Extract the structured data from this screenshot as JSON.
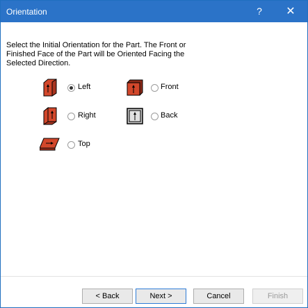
{
  "window": {
    "title": "Orientation",
    "help_glyph": "?",
    "close_glyph": "✕"
  },
  "instructions": "Select the Initial Orientation for the Part.  The Front or\nFinished Face of the Part will be Oriented Facing the\nSelected Direction.",
  "options": {
    "left": {
      "label": "Left",
      "selected": true,
      "icon": "part-left-icon"
    },
    "right": {
      "label": "Right",
      "selected": false,
      "icon": "part-right-icon"
    },
    "top": {
      "label": "Top",
      "selected": false,
      "icon": "part-top-icon"
    },
    "front": {
      "label": "Front",
      "selected": false,
      "icon": "part-front-icon"
    },
    "back": {
      "label": "Back",
      "selected": false,
      "icon": "part-back-icon"
    }
  },
  "buttons": {
    "back": "< Back",
    "next": "Next >",
    "cancel": "Cancel",
    "finish": "Finish"
  },
  "colors": {
    "titlebar": "#2b73c8",
    "part_face": "#d2472b",
    "back_face": "#c8c8c8"
  }
}
